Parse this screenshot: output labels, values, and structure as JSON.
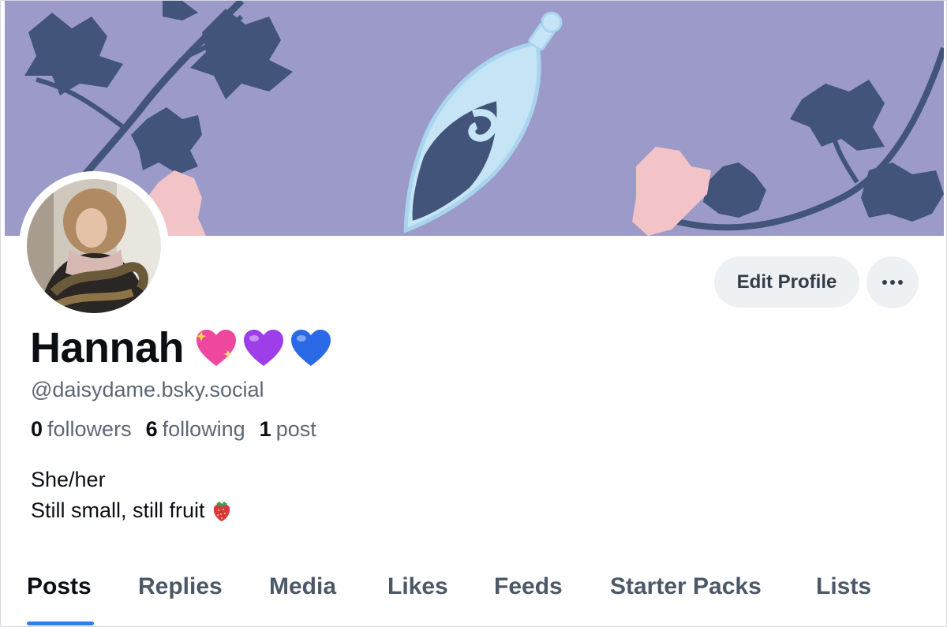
{
  "profile": {
    "display_name": "Hannah",
    "name_emojis": [
      "sparkling-heart-icon",
      "purple-heart-icon",
      "blue-heart-icon"
    ],
    "handle": "@daisydame.bsky.social",
    "stats": {
      "followers_count": "0",
      "followers_label": "followers",
      "following_count": "6",
      "following_label": "following",
      "posts_count": "1",
      "posts_label": "post"
    },
    "bio": {
      "line1": "She/her",
      "line2": "Still small, still fruit",
      "line2_icon": "strawberry-icon"
    }
  },
  "actions": {
    "edit_profile_label": "Edit Profile",
    "more_icon": "ellipsis-icon"
  },
  "tabs": [
    {
      "label": "Posts",
      "active": true
    },
    {
      "label": "Replies",
      "active": false
    },
    {
      "label": "Media",
      "active": false
    },
    {
      "label": "Likes",
      "active": false
    },
    {
      "label": "Feeds",
      "active": false
    },
    {
      "label": "Starter Packs",
      "active": false
    },
    {
      "label": "Lists",
      "active": false
    }
  ],
  "colors": {
    "banner_bg": "#9b9ac9",
    "banner_leaf": "#42547a",
    "banner_blossom": "#f2c3c7",
    "banner_bottle": "#c5e4f5",
    "accent": "#2f7ff1",
    "muted_text": "#5c6775",
    "button_bg": "#eef1f4"
  }
}
